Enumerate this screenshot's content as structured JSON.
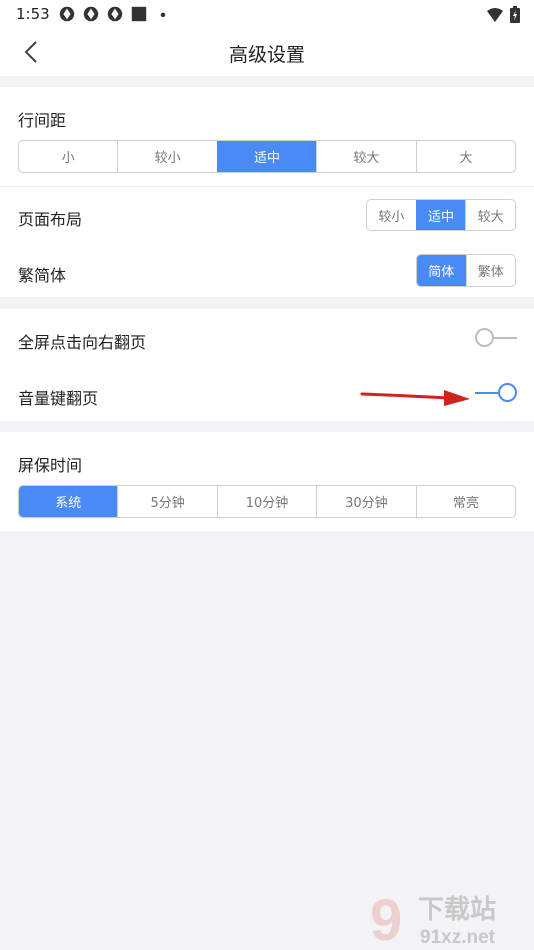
{
  "status_bar": {
    "time": "1:53",
    "left_icons": [
      "aperture-icon",
      "aperture-icon",
      "aperture-icon",
      "square-icon",
      "dot-icon"
    ],
    "right_icons": [
      "wifi-icon",
      "battery-icon"
    ]
  },
  "header": {
    "title": "高级设置",
    "back_icon": "chevron-left-icon"
  },
  "line_spacing": {
    "label": "行间距",
    "options": [
      "小",
      "较小",
      "适中",
      "较大",
      "大"
    ],
    "selected": "适中"
  },
  "page_layout": {
    "label": "页面布局",
    "options": [
      "较小",
      "适中",
      "较大"
    ],
    "selected": "适中"
  },
  "script_style": {
    "label": "繁简体",
    "options": [
      "简体",
      "繁体"
    ],
    "selected": "简体"
  },
  "fullscreen_tap": {
    "label": "全屏点击向右翻页",
    "enabled": false
  },
  "volume_key": {
    "label": "音量键翻页",
    "enabled": true
  },
  "screen_timeout": {
    "label": "屏保时间",
    "options": [
      "系统",
      "5分钟",
      "10分钟",
      "30分钟",
      "常亮"
    ],
    "selected": "系统"
  },
  "watermark": {
    "logo_text": "9",
    "brand": "下载站",
    "domain": "91xz.net"
  },
  "colors": {
    "accent": "#4a8af4",
    "background": "#f2f2f7",
    "annotation_arrow": "#d0221c"
  }
}
